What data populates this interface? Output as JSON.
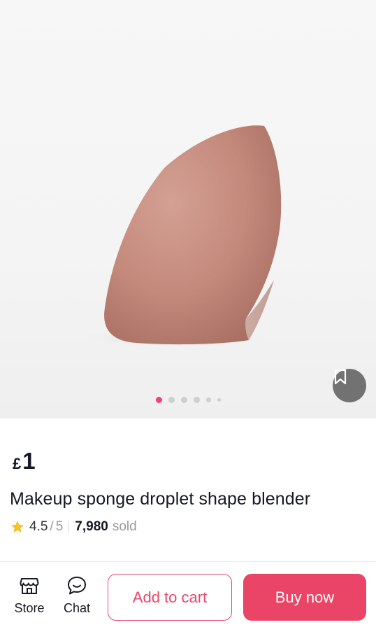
{
  "product": {
    "image_alt": "Makeup sponge droplet shape blender product photo",
    "carousel": {
      "total": 6,
      "active": 1
    },
    "currency_symbol": "£",
    "price": "1",
    "title": "Makeup sponge droplet shape blender",
    "rating": {
      "score": "4.5",
      "slash": "/",
      "max": "5",
      "sold_count": "7,980",
      "sold_label": "sold"
    }
  },
  "bottom_bar": {
    "store_label": "Store",
    "chat_label": "Chat",
    "add_to_cart_label": "Add to cart",
    "buy_now_label": "Buy now"
  },
  "colors": {
    "accent": "#ea4466",
    "accent_border": "#e8476b",
    "carousel_active_dot": "#f0456a",
    "star": "#f6c12b",
    "sponge": "#c48a7c"
  },
  "icons": {
    "save": "bookmark-icon",
    "rating": "star-icon",
    "store": "store-icon",
    "chat": "chat-bubble-icon"
  }
}
